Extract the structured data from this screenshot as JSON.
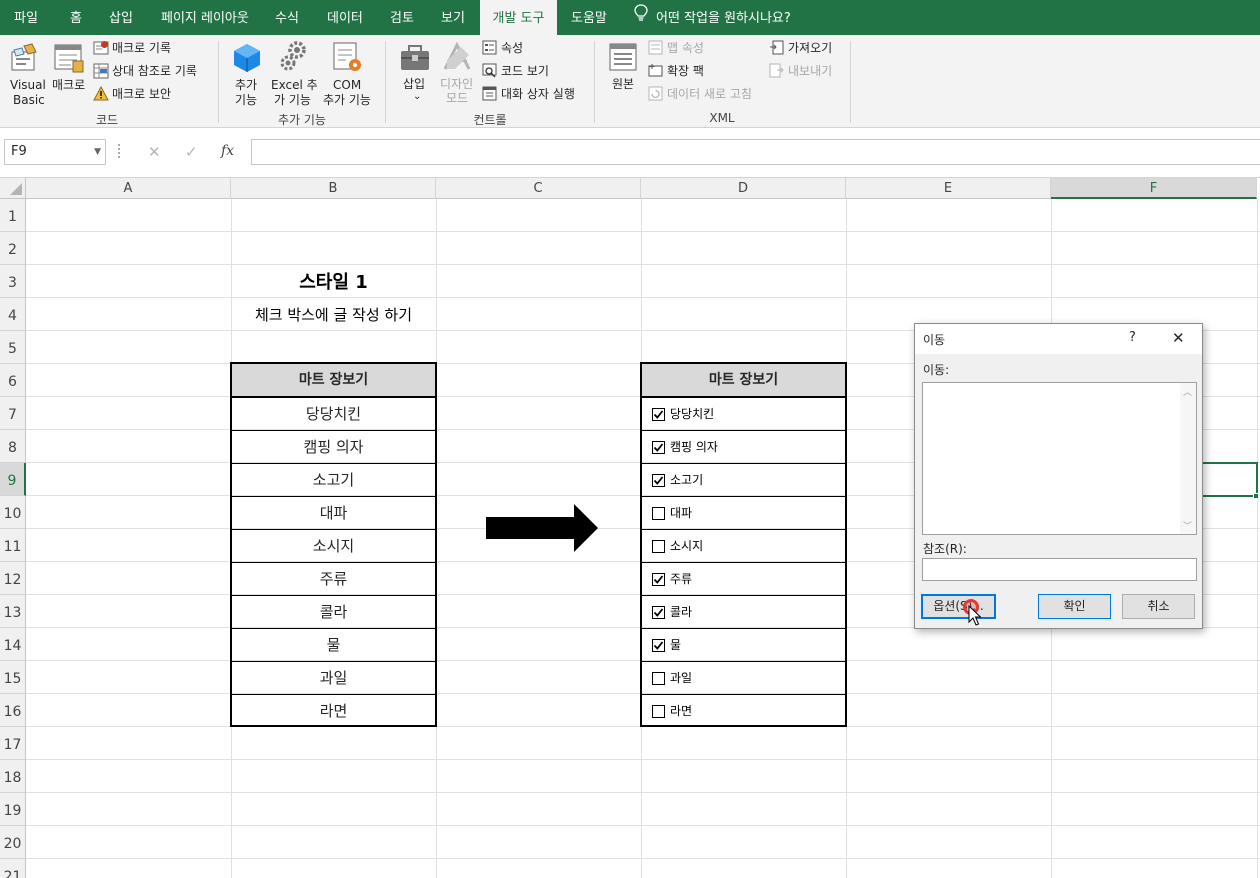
{
  "ribbon": {
    "tabs": [
      "파일",
      "홈",
      "삽입",
      "페이지 레이아웃",
      "수식",
      "데이터",
      "검토",
      "보기",
      "개발 도구",
      "도움말"
    ],
    "active_tab": "개발 도구",
    "tell_me": "어떤 작업을 원하시나요?",
    "groups": {
      "code": {
        "label": "코드",
        "visual_basic": [
          "Visual",
          "Basic"
        ],
        "macros": "매크로",
        "record_macro": "매크로 기록",
        "relative_ref": "상대 참조로 기록",
        "macro_security": "매크로 보안"
      },
      "addins": {
        "label": "추가 기능",
        "addins": [
          "추가",
          "기능"
        ],
        "excel_addins": [
          "Excel 추",
          "가 기능"
        ],
        "com_addins": [
          "COM",
          "추가 기능"
        ]
      },
      "controls": {
        "label": "컨트롤",
        "insert": "삽입",
        "insert_caret": "⌄",
        "design_mode": [
          "디자인",
          "모드"
        ],
        "properties": "속성",
        "view_code": "코드 보기",
        "run_dialog": "대화 상자 실행"
      },
      "xml": {
        "label": "XML",
        "source": "원본",
        "map_properties": "맵 속성",
        "expansion_packs": "확장 팩",
        "refresh_data": "데이터 새로 고침",
        "import": "가져오기",
        "export": "내보내기"
      }
    }
  },
  "formula_bar": {
    "name_box": "F9",
    "cancel": "✕",
    "enter": "✓",
    "fx": "fx",
    "formula": ""
  },
  "sheet": {
    "columns": [
      "A",
      "B",
      "C",
      "D",
      "E",
      "F"
    ],
    "selected_column": "F",
    "rows": [
      "1",
      "2",
      "3",
      "4",
      "5",
      "6",
      "7",
      "8",
      "9",
      "10",
      "11",
      "12",
      "13",
      "14",
      "15",
      "16",
      "17",
      "18",
      "19",
      "20",
      "21"
    ],
    "selected_row": "9",
    "title": "스타일 1",
    "subtitle": "체크 박스에 글 작성 하기",
    "left_table": {
      "header": "마트 장보기",
      "items": [
        "당당치킨",
        "캠핑 의자",
        "소고기",
        "대파",
        "소시지",
        "주류",
        "콜라",
        "물",
        "과일",
        "라면"
      ]
    },
    "right_table": {
      "header": "마트 장보기",
      "items": [
        {
          "label": "당당치킨",
          "checked": true
        },
        {
          "label": "캠핑 의자",
          "checked": true
        },
        {
          "label": "소고기",
          "checked": true
        },
        {
          "label": "대파",
          "checked": false
        },
        {
          "label": "소시지",
          "checked": false
        },
        {
          "label": "주류",
          "checked": true
        },
        {
          "label": "콜라",
          "checked": true
        },
        {
          "label": "물",
          "checked": true
        },
        {
          "label": "과일",
          "checked": false
        },
        {
          "label": "라면",
          "checked": false
        }
      ]
    }
  },
  "dialog": {
    "title": "이동",
    "help": "?",
    "close": "✕",
    "goto_label": "이동:",
    "reference_label": "참조(R):",
    "options_button": "옵션(S)...",
    "ok_button": "확인",
    "cancel_button": "취소"
  },
  "colors": {
    "accent": "#217346",
    "ribbon_bg": "#f3f3f3",
    "header_fill": "#d9d9d9",
    "selection": "#217346"
  }
}
